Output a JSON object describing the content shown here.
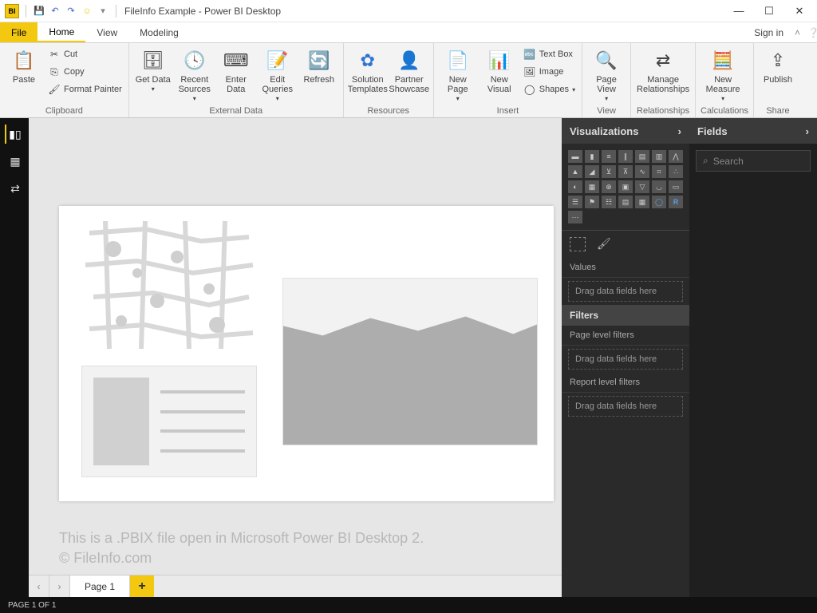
{
  "titlebar": {
    "title": "FileInfo Example - Power BI Desktop",
    "qat_smiley": "☺"
  },
  "menu": {
    "file": "File",
    "tabs": [
      "Home",
      "View",
      "Modeling"
    ],
    "active_tab": "Home",
    "signin": "Sign in"
  },
  "ribbon": {
    "clipboard": {
      "label": "Clipboard",
      "paste": "Paste",
      "cut": "Cut",
      "copy": "Copy",
      "format_painter": "Format Painter"
    },
    "external": {
      "label": "External Data",
      "get_data": "Get Data",
      "recent_sources": "Recent Sources",
      "enter_data": "Enter Data",
      "edit_queries": "Edit Queries",
      "refresh": "Refresh"
    },
    "resources": {
      "label": "Resources",
      "solution_templates": "Solution Templates",
      "partner_showcase": "Partner Showcase"
    },
    "insert": {
      "label": "Insert",
      "new_page": "New Page",
      "new_visual": "New Visual",
      "text_box": "Text Box",
      "image": "Image",
      "shapes": "Shapes"
    },
    "view": {
      "label": "View",
      "page_view": "Page View"
    },
    "relationships": {
      "label": "Relationships",
      "manage": "Manage Relationships"
    },
    "calculations": {
      "label": "Calculations",
      "new_measure": "New Measure"
    },
    "share": {
      "label": "Share",
      "publish": "Publish"
    }
  },
  "panes": {
    "visualizations": "Visualizations",
    "values": "Values",
    "drag_here": "Drag data fields here",
    "filters": "Filters",
    "page_filters": "Page level filters",
    "report_filters": "Report level filters",
    "fields": "Fields",
    "search": "Search",
    "r_icon": "R"
  },
  "canvas": {
    "watermark_line1": "This is a .PBIX file open in Microsoft Power BI Desktop 2.",
    "watermark_line2": "© FileInfo.com",
    "page_tab": "Page 1"
  },
  "status": {
    "page": "PAGE 1 OF 1"
  }
}
